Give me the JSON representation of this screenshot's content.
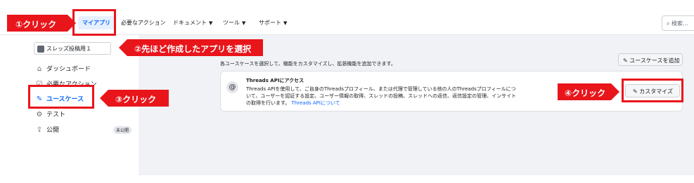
{
  "nav": {
    "items": [
      {
        "label": "マイアプリ",
        "caret": false
      },
      {
        "label": "必要なアクション",
        "caret": false
      },
      {
        "label": "ドキュメント",
        "caret": true
      },
      {
        "label": "ツール",
        "caret": true
      },
      {
        "label": "サポート",
        "caret": true
      }
    ],
    "search_placeholder": "検索..."
  },
  "sidebar": {
    "app_name": "スレッズ投稿用１",
    "items": [
      {
        "label": "ダッシュボード",
        "icon": "home-icon"
      },
      {
        "label": "必要なアクション",
        "icon": "checklist-icon"
      },
      {
        "label": "ユースケース",
        "icon": "pencil-icon"
      },
      {
        "label": "テスト",
        "icon": "test-icon"
      },
      {
        "label": "公開",
        "icon": "upload-icon"
      }
    ],
    "badge": "未公開"
  },
  "main": {
    "description": "各ユースケースを選択して、機能をカスタマイズし、拡張機能を追加できます。",
    "add_usecase_label": "ユースケースを追加",
    "card": {
      "title": "Threads APIにアクセス",
      "body": "Threads APIを使用して、ご自身のThreadsプロフィール、または代理で管理している他の人のThreadsプロフィールについて、ユーザーを認証する設定、ユーザー情報の取得、スレッドの投稿、スレッドへの返信、返信設定の管理、インサイトの取得を行います。",
      "link": "Threads APIについて",
      "customize_label": "カスタマイズ"
    }
  },
  "annotations": {
    "step1": "①クリック",
    "step2": "②先ほど作成したアプリを選択",
    "step3": "③クリック",
    "step4": "④クリック",
    "color": "#e8151b"
  }
}
